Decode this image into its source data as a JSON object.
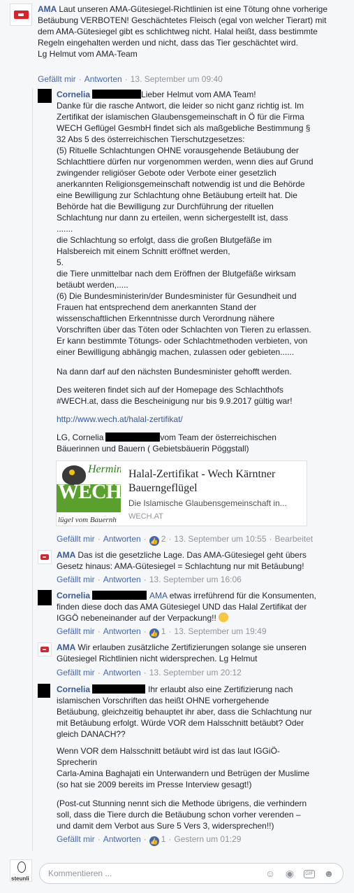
{
  "c1": {
    "author": "AMA",
    "text": "Laut unseren AMA-Gütesiegel-Richtlinien ist eine Tötung ohne vorherige Betäubung VERBOTEN! Geschächtetes Fleisch (egal von welcher Tierart) mit dem AMA-Gütesiegel gibt es schlichtweg nicht. Halal heißt, dass bestimmte Regeln eingehalten werden und nicht, dass das Tier geschächtet wird.",
    "sign": "Lg Helmut vom AMA-Team",
    "like": "Gefällt mir",
    "reply": "Antworten",
    "time": "13. September um 09:40"
  },
  "c2": {
    "author": "Cornelia",
    "lines": [
      "Lieber Helmut vom AMA Team!",
      "Danke für die rasche Antwort, die leider so nicht ganz richtig ist. Im",
      "Zertifikat der islamischen Glaubensgemeinschaft in Ö für die Firma",
      "WECH Geflügel GesmbH findet sich als maßgebliche Bestimmung §",
      "32 Abs 5 des österreichischen Tierschutzgesetzes:",
      "(5) Rituelle Schlachtungen OHNE vorausgehende Betäubung der",
      "Schlachttiere dürfen nur vorgenommen werden, wenn dies auf Grund",
      "zwingender religiöser Gebote oder Verbote einer gesetzlich",
      "anerkannten Religionsgemeinschaft notwendig ist und die Behörde",
      "eine Bewilligung zur Schlachtung ohne Betäubung erteilt hat. Die",
      "Behörde hat die Bewilligung zur Durchführung der rituellen",
      "Schlachtung nur dann zu erteilen, wenn sichergestellt ist, dass",
      ".......",
      "die Schlachtung so erfolgt, dass die großen Blutgefäße im",
      "Halsbereich mit einem Schnitt eröffnet werden,",
      "5.",
      "die Tiere unmittelbar nach dem Eröffnen der Blutgefäße wirksam",
      "betäubt werden,.....",
      "(6) Die Bundesministerin/der Bundesminister für Gesundheit und",
      "Frauen hat entsprechend dem anerkannten Stand der",
      "wissenschaftlichen Erkenntnisse durch Verordnung nähere",
      "Vorschriften über das Töten oder Schlachten von Tieren zu erlassen.",
      "Er kann bestimmte Tötungs- oder Schlachtmethoden verbieten, von",
      "einer Bewilligung abhängig machen, zulassen oder gebieten......"
    ],
    "p2": "Na dann darf auf den nächsten Bundesminister gehofft werden.",
    "p3a": "Des weiteren findet sich auf der Homepage des Schlachthofs",
    "p3b": "#WECH.at, dass die Bescheinigung nur bis 9.9.2017 gültig war!",
    "link": "http://www.wech.at/halal-zertifikat/",
    "sign_a": "LG, Cornelia",
    "sign_b": "vom Team der österreichischen",
    "sign_c": "Bäuerinnen und Bauern ( Gebietsbäuerin Pöggstall)",
    "card_title": "Halal-Zertifikat - Wech Kärntner Bauerngeflügel",
    "card_desc": "Die Islamische Glaubensgemeinschaft in...",
    "card_domain": "WECH.AT",
    "card_img_script": "Hermin",
    "card_img_word": "WECH",
    "card_img_sub": "lügel vom Bauernh",
    "like": "Gefällt mir",
    "reply": "Antworten",
    "likes": "2",
    "time": "13. September um 10:55",
    "edited": "Bearbeitet"
  },
  "c3": {
    "author": "AMA",
    "text_a": "Das ist die gesetzliche Lage. Das AMA-Gütesiegel geht übers",
    "text_b": "Gesetz hinaus: AMA-Gütesiegel = Schlachtung nur mit Betäubung!",
    "like": "Gefällt mir",
    "reply": "Antworten",
    "time": "13. September um 16:06"
  },
  "c4": {
    "author": "Cornelia",
    "tag": "AMA",
    "text_a": "etwas irreführend für die Konsumenten,",
    "text_b": "finden diese doch das AMA Gütesiegel UND das Halal Zertifikat der",
    "text_c": "IGGÖ nebeneinander auf der Verpackung!!",
    "like": "Gefällt mir",
    "reply": "Antworten",
    "likes": "1",
    "time": "13. September um 19:49"
  },
  "c5": {
    "author": "AMA",
    "text_a": "Wir erlauben zusätzliche Zertifizierungen solange sie unseren",
    "text_b": "Gütesiegel Richtlinien nicht widersprechen. Lg Helmut",
    "like": "Gefällt mir",
    "reply": "Antworten",
    "time": "13. September um 20:12"
  },
  "c6": {
    "author": "Cornelia",
    "l1": "Ihr erlaubt also eine Zertifizierung nach",
    "l2": "islamischen Vorschriften das heißt OHNE vorhergehende",
    "l3": "Betäubung, gleichzeitig behauptet ihr aber, dass die Schlachtung nur",
    "l4": "mit Betäubung erfolgt. Würde VOR dem Halsschnitt betäubt? Oder",
    "l5": "gleich DANACH??",
    "l6": "Wenn VOR dem Halsschnitt betäubt wird ist das laut IGGiÖ-",
    "l7": "Sprecherin",
    "l8": "Carla-Amina Baghajati ein Unterwandern und Betrügen der Muslime",
    "l9": "(so hat sie 2009 bereits im Presse Interview gesagt!)",
    "l10": "(Post-cut Stunning nennt sich die Methode übrigens, die verhindern",
    "l11": "soll, dass die Tiere durch die Betäubung schon vorher verenden –",
    "l12": "und damit dem Verbot aus Sure 5 Vers 3, widersprechen!!)",
    "like": "Gefällt mir",
    "reply": "Antworten",
    "likes": "1",
    "time": "Gestern um 01:29"
  },
  "composer": {
    "placeholder": "Kommentieren ...",
    "gif": "GIF",
    "avatar_label": "steunli"
  }
}
